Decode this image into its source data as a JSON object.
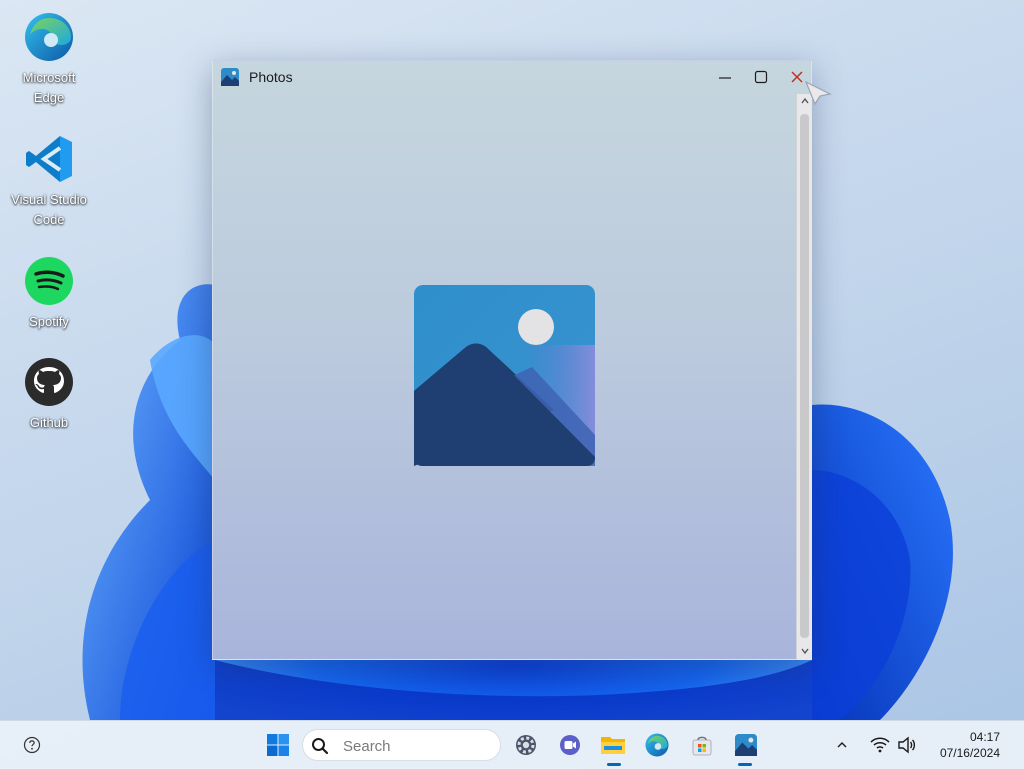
{
  "desktop": {
    "icons": [
      {
        "label_line1": "Microsoft",
        "label_line2": "Edge",
        "icon": "edge-icon"
      },
      {
        "label_line1": "Visual Studio",
        "label_line2": "Code",
        "icon": "vscode-icon"
      },
      {
        "label_line1": "Spotify",
        "label_line2": "",
        "icon": "spotify-icon"
      },
      {
        "label_line1": "Github",
        "label_line2": "",
        "icon": "github-icon"
      }
    ]
  },
  "window": {
    "title": "Photos",
    "app_icon": "photos-icon",
    "placeholder_icon": "image-placeholder-icon"
  },
  "taskbar": {
    "search_placeholder": "Search",
    "apps": [
      "start-icon",
      "search-icon",
      "settings-icon",
      "meet-icon",
      "file-explorer-icon",
      "edge-icon",
      "store-icon",
      "photos-icon"
    ],
    "tray": [
      "chevron-up-icon",
      "wifi-icon",
      "volume-icon"
    ],
    "time": "04:17",
    "date": "07/16/2024"
  },
  "colors": {
    "accent": "#0067c0",
    "close_hover": "#c42b1c"
  }
}
